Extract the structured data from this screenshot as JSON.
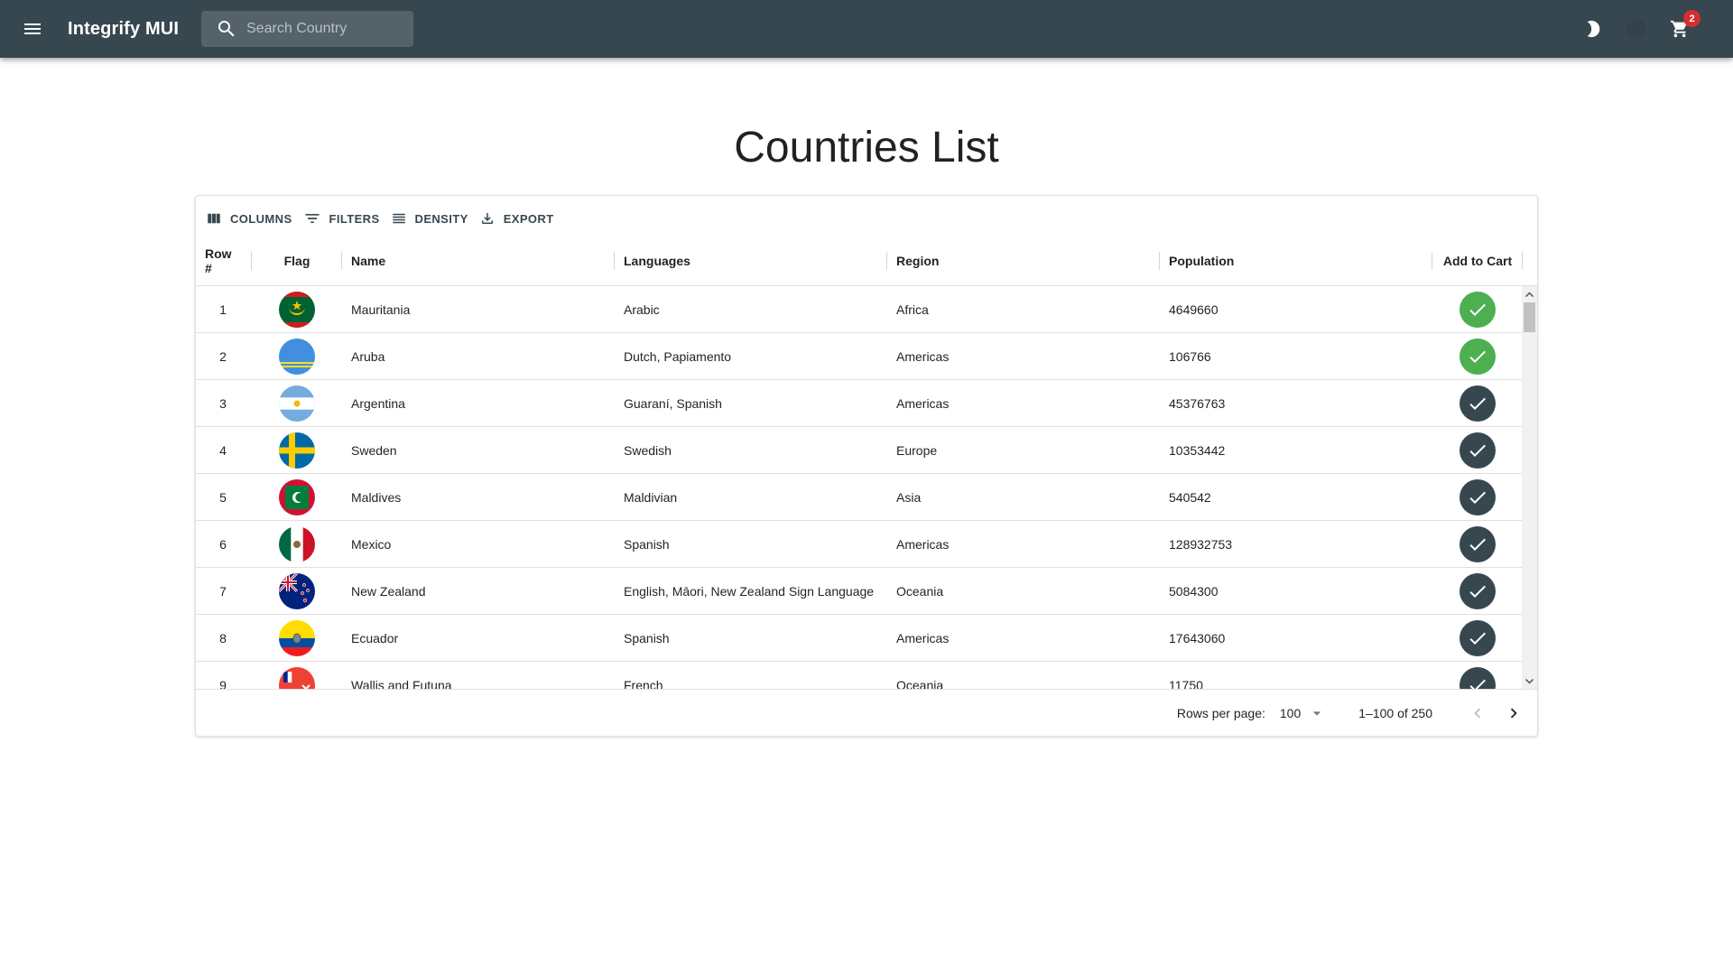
{
  "appbar": {
    "title": "Integrify MUI",
    "search_placeholder": "Search Country",
    "cart_count": "2",
    "background": "#37474f"
  },
  "page": {
    "title": "Countries List"
  },
  "toolbar": {
    "columns": "COLUMNS",
    "filters": "FILTERS",
    "density": "DENSITY",
    "export": "EXPORT"
  },
  "columns": {
    "row": "Row #",
    "flag": "Flag",
    "name": "Name",
    "languages": "Languages",
    "region": "Region",
    "population": "Population",
    "cart": "Add to Cart"
  },
  "colors": {
    "added": "#4caf50",
    "not_added": "#37474f"
  },
  "rows": [
    {
      "num": "1",
      "flag": "mauritania-flag-icon",
      "name": "Mauritania",
      "languages": "Arabic",
      "region": "Africa",
      "population": "4649660",
      "in_cart": true
    },
    {
      "num": "2",
      "flag": "aruba-flag-icon",
      "name": "Aruba",
      "languages": "Dutch, Papiamento",
      "region": "Americas",
      "population": "106766",
      "in_cart": true
    },
    {
      "num": "3",
      "flag": "argentina-flag-icon",
      "name": "Argentina",
      "languages": "Guaraní, Spanish",
      "region": "Americas",
      "population": "45376763",
      "in_cart": false
    },
    {
      "num": "4",
      "flag": "sweden-flag-icon",
      "name": "Sweden",
      "languages": "Swedish",
      "region": "Europe",
      "population": "10353442",
      "in_cart": false
    },
    {
      "num": "5",
      "flag": "maldives-flag-icon",
      "name": "Maldives",
      "languages": "Maldivian",
      "region": "Asia",
      "population": "540542",
      "in_cart": false
    },
    {
      "num": "6",
      "flag": "mexico-flag-icon",
      "name": "Mexico",
      "languages": "Spanish",
      "region": "Americas",
      "population": "128932753",
      "in_cart": false
    },
    {
      "num": "7",
      "flag": "new-zealand-flag-icon",
      "name": "New Zealand",
      "languages": "English, Māori, New Zealand Sign Language",
      "region": "Oceania",
      "population": "5084300",
      "in_cart": false
    },
    {
      "num": "8",
      "flag": "ecuador-flag-icon",
      "name": "Ecuador",
      "languages": "Spanish",
      "region": "Americas",
      "population": "17643060",
      "in_cart": false
    },
    {
      "num": "9",
      "flag": "wallis-and-futuna-flag-icon",
      "name": "Wallis and Futuna",
      "languages": "French",
      "region": "Oceania",
      "population": "11750",
      "in_cart": false
    }
  ],
  "footer": {
    "rows_per_page_label": "Rows per page:",
    "rows_per_page_value": "100",
    "page_info": "1–100 of 250"
  }
}
